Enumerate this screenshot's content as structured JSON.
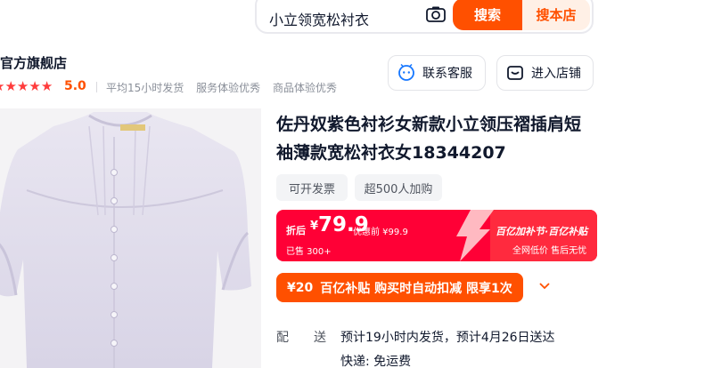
{
  "search": {
    "query": "小立领宽松衬衣",
    "search_label": "搜索",
    "store_search_label": "搜本店"
  },
  "shop": {
    "name": "官方旗舰店",
    "rating": "5.0",
    "stars": 5,
    "service_tags": [
      "平均15小时发货",
      "服务体验优秀",
      "商品体验优秀"
    ],
    "customer_service_label": "联系客服",
    "enter_store_label": "进入店铺"
  },
  "product": {
    "title": "佐丹奴紫色衬衫女新款小立领压褶插肩短袖薄款宽松衬衣女18344207",
    "tags": [
      "可开发票",
      "超500人加购"
    ],
    "price": {
      "label": "折后",
      "currency": "¥",
      "value": "79.9",
      "original": "优惠前 ¥99.9",
      "sold": "已售 300+"
    },
    "subsidy": {
      "title": "百亿加补节·百亿补贴",
      "subtitle": "全网低价 售后无忧"
    },
    "coupon": {
      "amount": "¥20",
      "text": "百亿补贴 购买时自动扣减 限享1次"
    },
    "shipping": {
      "label_a": "配",
      "label_b": "送",
      "info": "预计19小时内发货，预计4月26日送达",
      "courier": "快递: 免运费"
    }
  },
  "colors": {
    "accent": "#ff5000",
    "price_banner": "#ff0036",
    "star": "#ff3b3b"
  }
}
